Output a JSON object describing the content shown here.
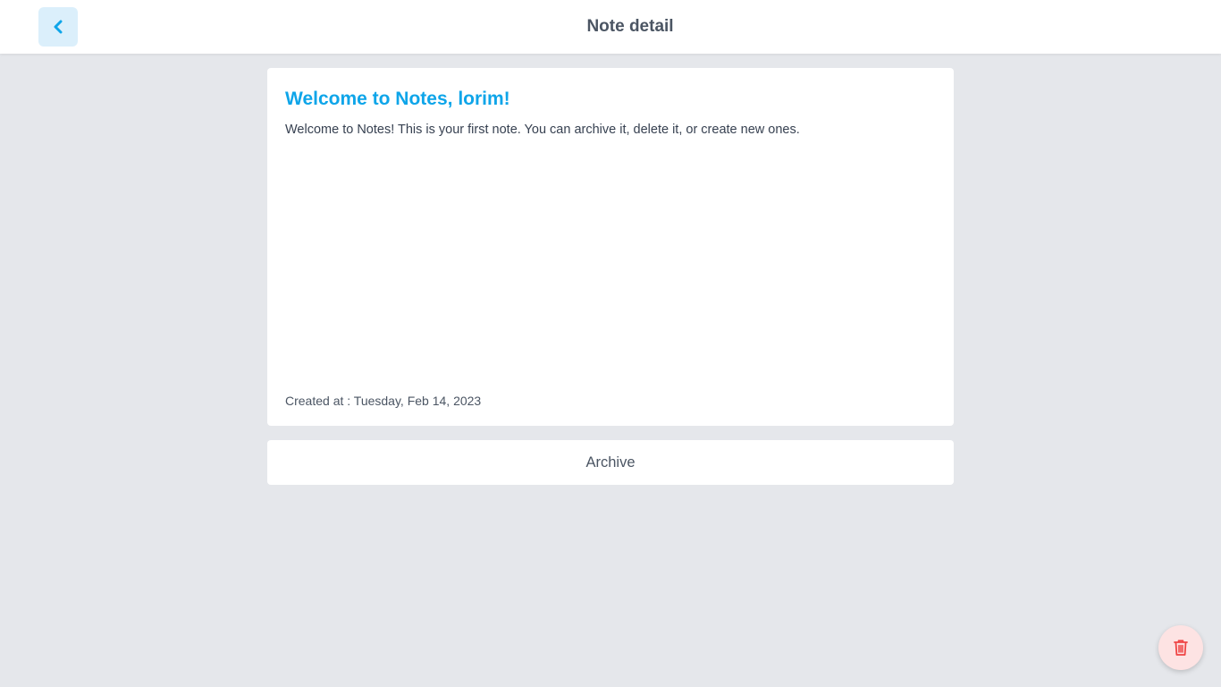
{
  "header": {
    "title": "Note detail",
    "back_icon": "chevron-left-icon"
  },
  "note": {
    "title": "Welcome to Notes, lorim!",
    "body": "Welcome to Notes! This is your first note. You can archive it, delete it, or create new ones.",
    "created": "Created at : Tuesday, Feb 14, 2023"
  },
  "actions": {
    "archive_label": "Archive",
    "delete_icon": "trash-icon"
  },
  "colors": {
    "accent": "#0ea5e9",
    "background": "#e5e7eb",
    "danger": "#ef4444"
  }
}
